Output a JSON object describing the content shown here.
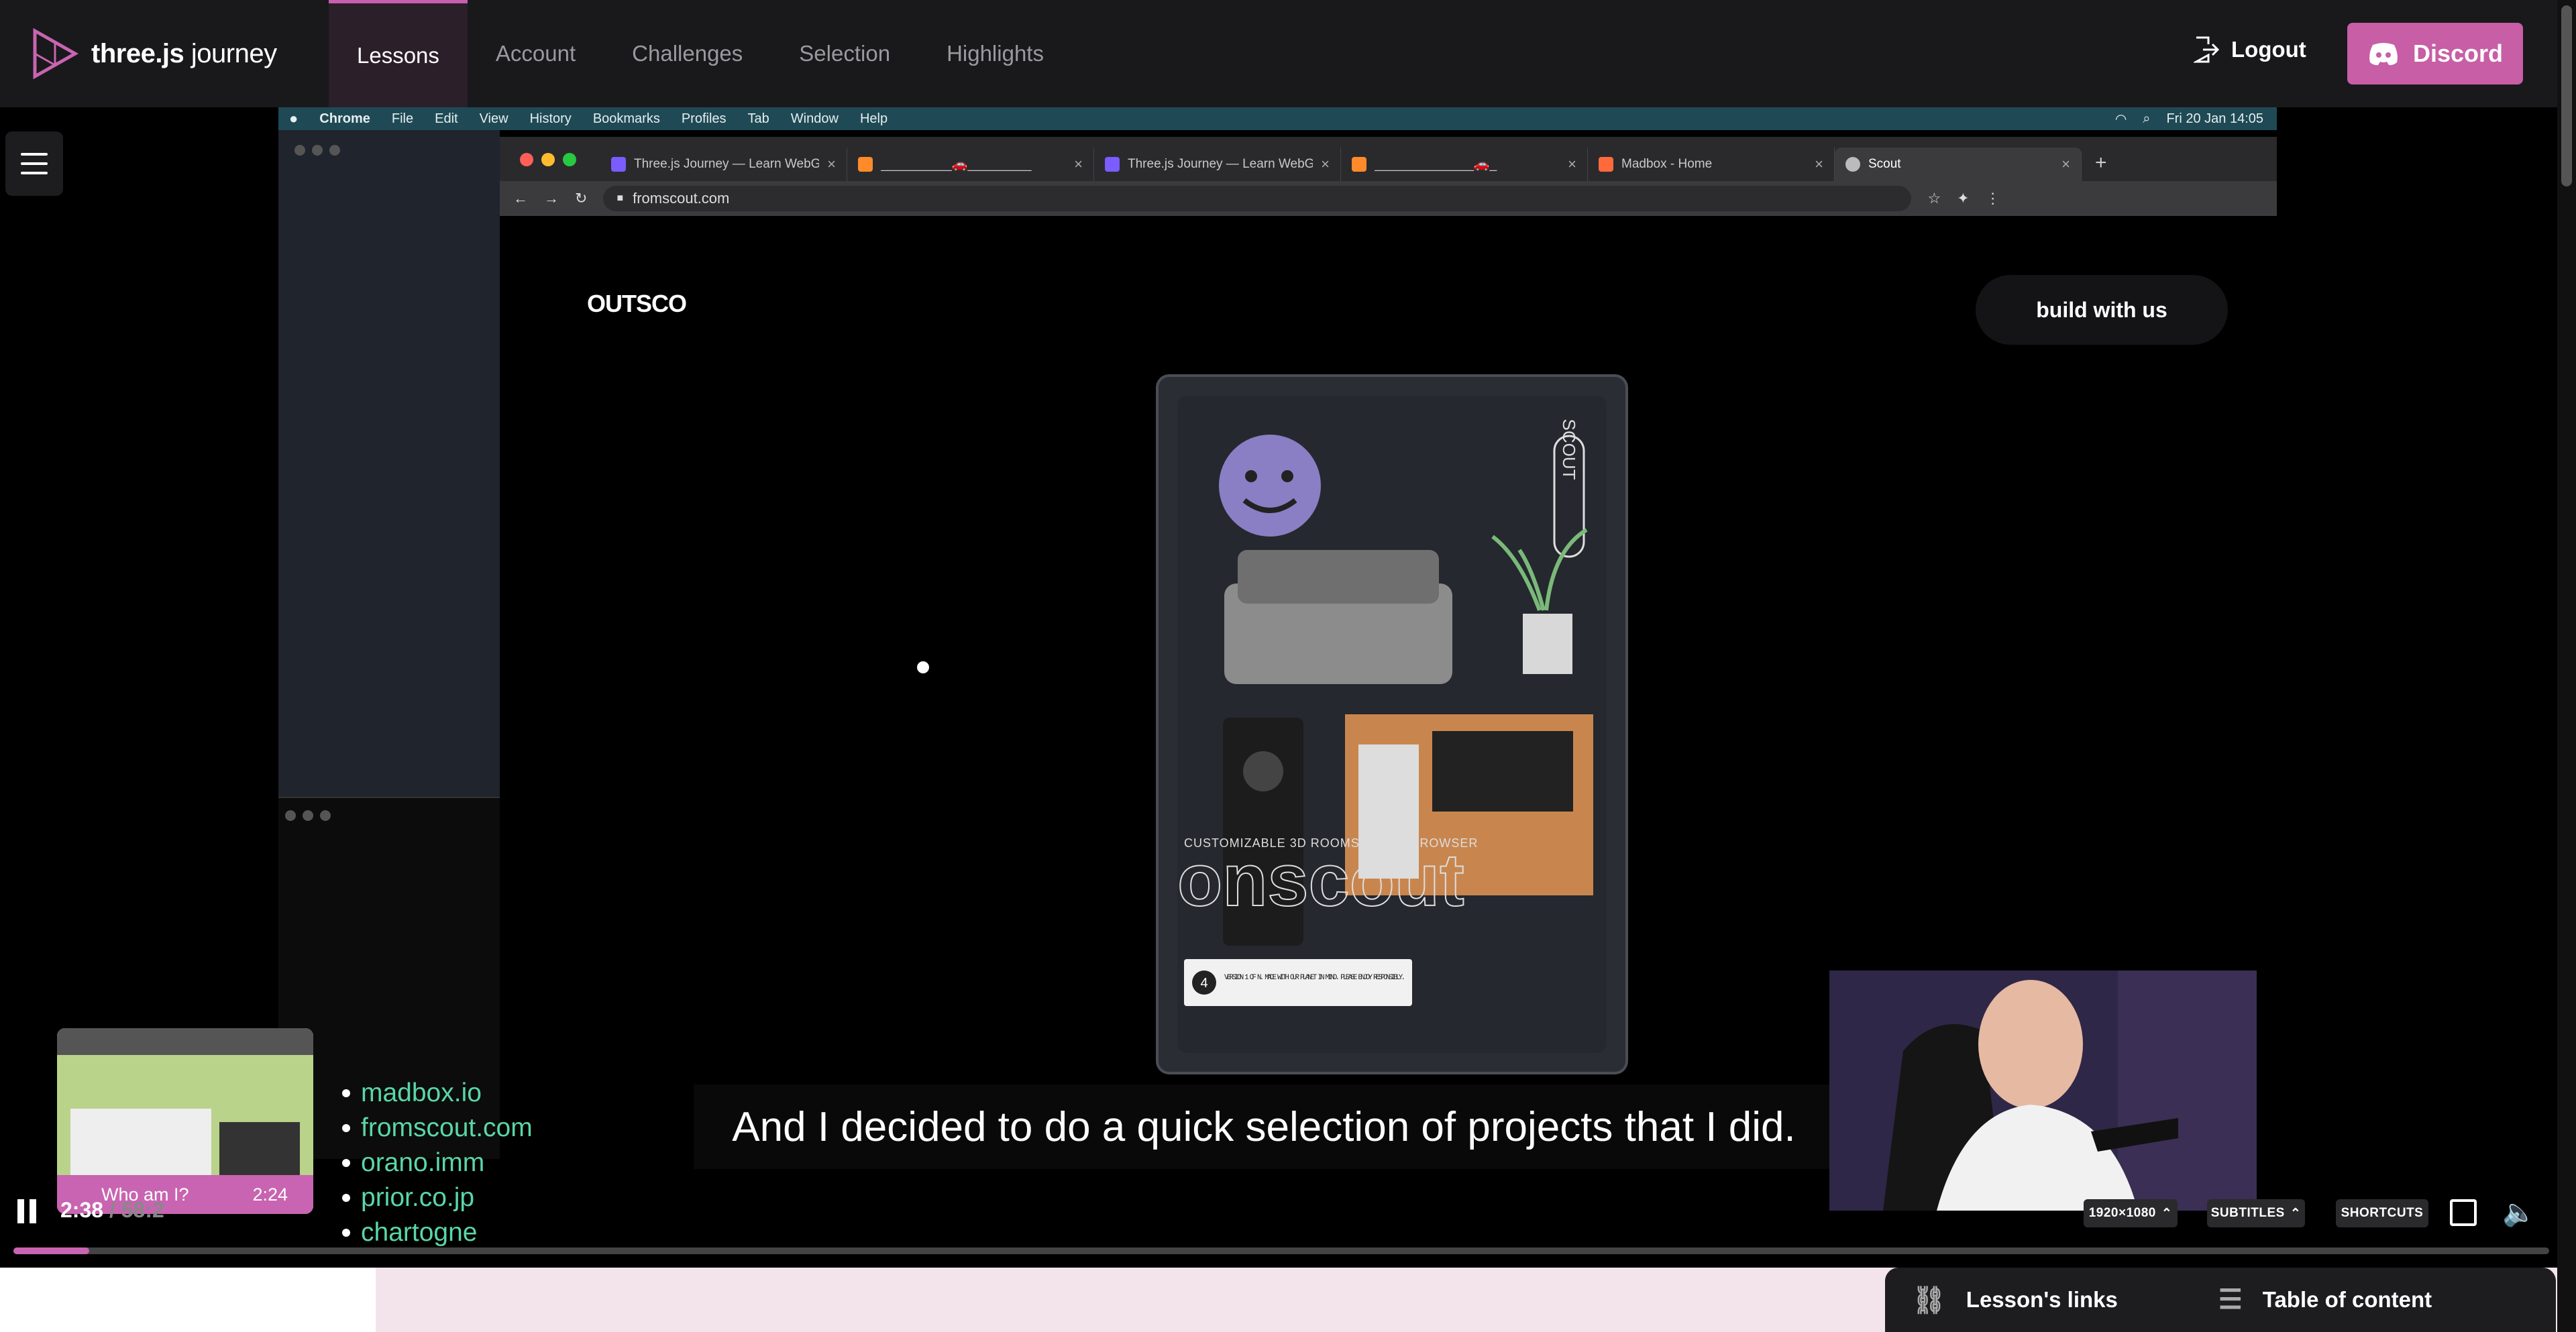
{
  "site": {
    "brand_bold": "three.js",
    "brand_rest": " journey"
  },
  "nav": {
    "items": [
      {
        "label": "Lessons",
        "active": true
      },
      {
        "label": "Account",
        "active": false
      },
      {
        "label": "Challenges",
        "active": false
      },
      {
        "label": "Selection",
        "active": false
      },
      {
        "label": "Highlights",
        "active": false
      }
    ],
    "logout_label": "Logout",
    "discord_label": "Discord"
  },
  "mac_menubar": {
    "items": [
      "Chrome",
      "File",
      "Edit",
      "View",
      "History",
      "Bookmarks",
      "Profiles",
      "Tab",
      "Window",
      "Help"
    ],
    "datetime": "Fri 20 Jan  14:05"
  },
  "browser": {
    "tabs": [
      {
        "title": "Three.js Journey — Learn WebGL",
        "icon_color": "#7a5cff"
      },
      {
        "title": "__________🚗_________",
        "icon_color": "#ff8a2a"
      },
      {
        "title": "Three.js Journey — Learn WebGL",
        "icon_color": "#7a5cff"
      },
      {
        "title": "______________🚗_",
        "icon_color": "#ff8a2a"
      },
      {
        "title": "Madbox - Home",
        "icon_color": "#ff6a3d"
      },
      {
        "title": "Scout",
        "icon_color": "#bbbbbb",
        "active": true
      }
    ],
    "url": "fromscout.com"
  },
  "scout_page": {
    "logo": "OUTSCO",
    "build_button": "build with us",
    "tagline": "CUSTOMIZABLE 3D ROOMS IN THE BROWSER",
    "big_word": "onscout",
    "vertical_label": "SCOUT",
    "card_text": "VERSION 1 OF N. MADE WITH OUR PLANET IN MIND. PLEASE ENJOY RESPONSIBLY.",
    "card_number": "4"
  },
  "lesson_links": [
    "madbox.io",
    "fromscout.com",
    "orano.imm",
    "prior.co.jp",
    "chartogne"
  ],
  "subtitle": "And I decided to do a quick selection of projects that I did.",
  "preview": {
    "chapter": "Who am I?",
    "time": "2:24"
  },
  "player": {
    "current_time": "2:38",
    "duration": "58:2",
    "progress_fraction": 0.03,
    "resolution": "1920×1080",
    "subtitles_label": "SUBTITLES",
    "shortcuts_label": "SHORTCUTS"
  },
  "bottom_panel": {
    "links_label": "Lesson's links",
    "toc_label": "Table of content"
  },
  "colors": {
    "accent": "#c864b1",
    "link_green": "#5ad6a7",
    "menubar_teal": "#1f4a55"
  }
}
